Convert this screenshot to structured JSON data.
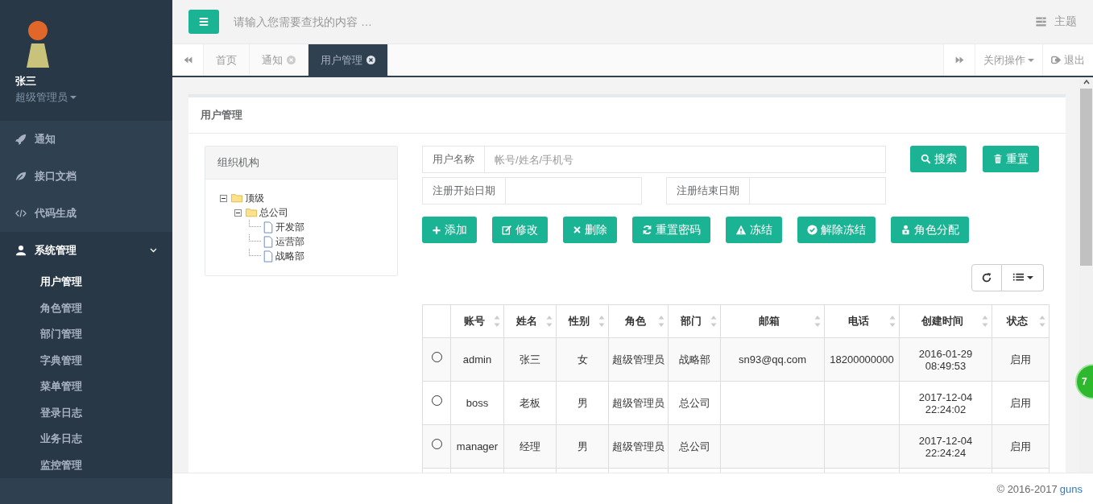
{
  "sidebar": {
    "user": {
      "name": "张三",
      "role": "超级管理员"
    },
    "menu": [
      {
        "label": "通知",
        "selected": false
      },
      {
        "label": "接口文档",
        "selected": false
      },
      {
        "label": "代码生成",
        "selected": false
      },
      {
        "label": "系统管理",
        "selected": true,
        "expanded": true,
        "children": [
          {
            "label": "用户管理",
            "selected": true
          },
          {
            "label": "角色管理",
            "selected": false
          },
          {
            "label": "部门管理",
            "selected": false
          },
          {
            "label": "字典管理",
            "selected": false
          },
          {
            "label": "菜单管理",
            "selected": false
          },
          {
            "label": "登录日志",
            "selected": false
          },
          {
            "label": "业务日志",
            "selected": false
          },
          {
            "label": "监控管理",
            "selected": false
          }
        ]
      }
    ]
  },
  "header": {
    "search_placeholder": "请输入您需要查找的内容 …",
    "theme": "主题"
  },
  "tabs": [
    {
      "label": "首页",
      "selected": false,
      "closable": false
    },
    {
      "label": "通知",
      "selected": false,
      "closable": true
    },
    {
      "label": "用户管理",
      "selected": true,
      "closable": true
    }
  ],
  "tab_actions": {
    "close_menu": "关闭操作",
    "logout": "退出"
  },
  "panel": {
    "title": "用户管理",
    "org": {
      "title": "组织机构",
      "tree": [
        {
          "label": "顶级",
          "expanded": true,
          "children": [
            {
              "label": "总公司",
              "expanded": true,
              "children": [
                {
                  "label": "开发部"
                },
                {
                  "label": "运营部"
                },
                {
                  "label": "战略部"
                }
              ]
            }
          ]
        }
      ]
    },
    "fields": [
      {
        "label": "用户名称",
        "placeholder": "帐号/姓名/手机号"
      },
      {
        "label": "注册开始日期"
      },
      {
        "label": "注册结束日期"
      }
    ],
    "search_buttons": [
      "搜索",
      "重置"
    ],
    "actions": [
      "添加",
      "修改",
      "删除",
      "重置密码",
      "冻结",
      "解除冻结",
      "角色分配"
    ],
    "table": {
      "columns": [
        "账号",
        "姓名",
        "性别",
        "角色",
        "部门",
        "邮箱",
        "电话",
        "创建时间",
        "状态"
      ],
      "rows": [
        {
          "selected": false,
          "cells": [
            "admin",
            "张三",
            "女",
            "超级管理员",
            "战略部",
            "sn93@qq.com",
            "18200000000",
            "2016-01-29 08:49:53",
            "启用"
          ]
        },
        {
          "selected": false,
          "cells": [
            "boss",
            "老板",
            "男",
            "超级管理员",
            "总公司",
            "",
            "",
            "2017-12-04 22:24:02",
            "启用"
          ]
        },
        {
          "selected": false,
          "cells": [
            "manager",
            "经理",
            "男",
            "超级管理员",
            "总公司",
            "",
            "",
            "2017-12-04 22:24:24",
            "启用"
          ]
        }
      ]
    }
  },
  "footer": {
    "copyright": "© 2016-2017",
    "link": "guns"
  },
  "floating_badge": "7"
}
